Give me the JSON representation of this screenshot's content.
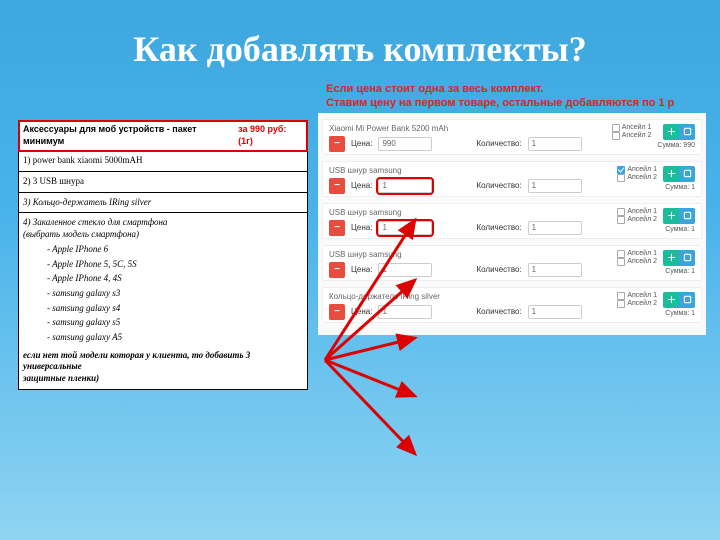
{
  "title": "Как добавлять комплекты?",
  "note_line1": "Если цена стоит одна за весь комплект.",
  "note_line2": "Ставим цену на первом товаре, остальные добавляются по 1 р",
  "left": {
    "header_prefix": "Аксессуары для моб устройств - пакет минимум ",
    "header_price": "за 990 руб: (1г)",
    "r1": "1) power bank xiaomi 5000mAH",
    "r2": "2) 3 USB шнура",
    "r3": "3) Кольцо-держатель IRing silver",
    "r4_head": "4) Закаленное стекло для смартфона",
    "r4_sub": "(выбрать модель смартфона)",
    "models": [
      "- Apple IPhone 6",
      "- Apple IPhone 5, 5C, 5S",
      "- Apple IPhone 4, 4S",
      "- samsung galaxy s3",
      "- samsung galaxy s4",
      "- samsung galaxy s5",
      "- samsung galaxy A5"
    ],
    "footer1": "если нет той модели которая у клиента, то добавить 3 универсальные",
    "footer2": "защитные пленки)"
  },
  "labels": {
    "price": "Цена:",
    "qty": "Количество:",
    "upsell1": "Апсейл 1",
    "upsell2": "Апсейл 2",
    "sum": "Сумма:"
  },
  "rows": [
    {
      "name": "Xiaomi Mi Power Bank 5200 mAh",
      "price": "990",
      "qty": "1",
      "sum": "990",
      "hl": false,
      "up1": false,
      "up2": false
    },
    {
      "name": "USB шнур samsung",
      "price": "1",
      "qty": "1",
      "sum": "1",
      "hl": true,
      "up1": true,
      "up2": false
    },
    {
      "name": "USB шнур samsung",
      "price": "1",
      "qty": "1",
      "sum": "1",
      "hl": true,
      "up1": false,
      "up2": false
    },
    {
      "name": "USB шнур samsung",
      "price": "1",
      "qty": "1",
      "sum": "1",
      "hl": false,
      "up1": false,
      "up2": false
    },
    {
      "name": "Кольцо-держатель IRing silver",
      "price": "1",
      "qty": "1",
      "sum": "1",
      "hl": false,
      "up1": false,
      "up2": false
    }
  ]
}
